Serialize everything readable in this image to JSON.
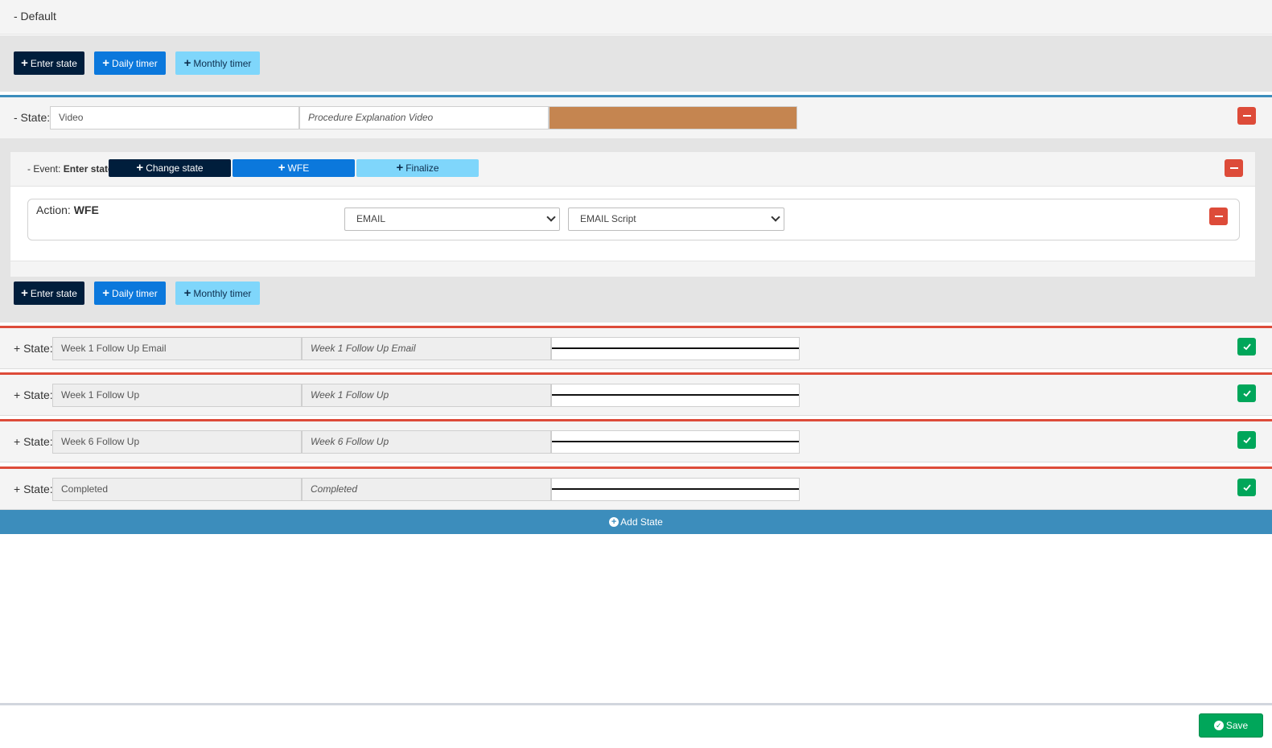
{
  "default_section": {
    "label": "- Default",
    "triggers": {
      "enter_state": "Enter state",
      "daily_timer": "Daily timer",
      "monthly_timer": "Monthly timer"
    }
  },
  "expanded_state": {
    "prefix": "- State:",
    "name_value": "Video",
    "description_value": "Procedure Explanation Video",
    "color": "#c58550",
    "event": {
      "prefix": "- Event:",
      "name": "Enter state",
      "buttons": {
        "change_state": "Change state",
        "wfe": "WFE",
        "finalize": "Finalize"
      },
      "action": {
        "prefix": "Action:",
        "name": "WFE",
        "channel_select": "EMAIL",
        "script_select": "EMAIL Script"
      }
    },
    "triggers": {
      "enter_state": "Enter state",
      "daily_timer": "Daily timer",
      "monthly_timer": "Monthly timer"
    }
  },
  "collapsed_states": [
    {
      "prefix": "+ State:",
      "name_value": "Week 1 Follow Up Email",
      "description_value": "Week 1 Follow Up Email"
    },
    {
      "prefix": "+ State:",
      "name_value": "Week 1 Follow Up",
      "description_value": "Week 1 Follow Up"
    },
    {
      "prefix": "+ State:",
      "name_value": "Week 6 Follow Up",
      "description_value": "Week 6 Follow Up"
    },
    {
      "prefix": "+ State:",
      "name_value": "Completed",
      "description_value": "Completed"
    }
  ],
  "add_state_label": "Add State",
  "save_label": "Save",
  "colors": {
    "dark_button": "#001e3c",
    "blue_button": "#0b78dc",
    "light_button": "#7fd6fb",
    "danger": "#dd4b39",
    "success": "#00a65a",
    "primary_bar": "#3c8dbc"
  },
  "icons": {
    "plus": "plus-icon",
    "minus": "minus-icon",
    "check": "check-icon",
    "chevron": "chevron-down-icon",
    "plus_circle": "plus-circle-icon",
    "check_circle": "check-circle-icon"
  }
}
